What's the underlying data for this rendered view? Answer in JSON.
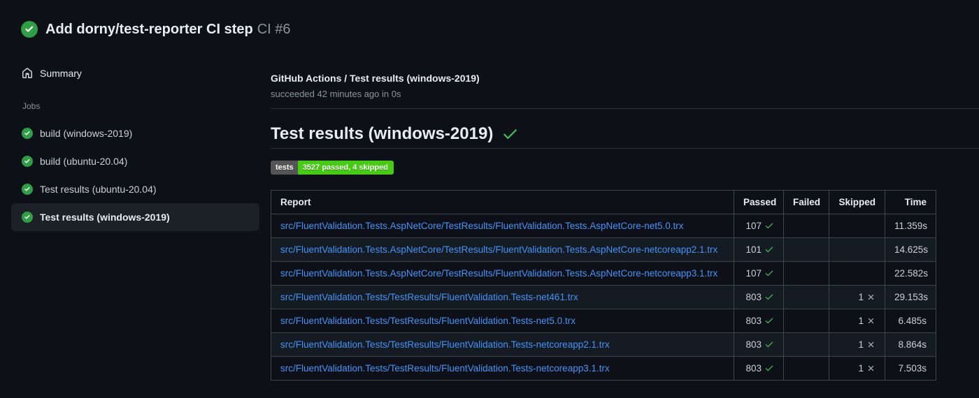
{
  "run_header": {
    "title": "Add dorny/test-reporter CI step",
    "run_ref": "CI #6",
    "status_icon": "check-circle-icon"
  },
  "sidebar": {
    "summary_label": "Summary",
    "summary_icon": "home-icon",
    "jobs_label": "Jobs",
    "jobs": [
      {
        "label": "build (windows-2019)",
        "selected": false,
        "status_icon": "check-circle-icon"
      },
      {
        "label": "build (ubuntu-20.04)",
        "selected": false,
        "status_icon": "check-circle-icon"
      },
      {
        "label": "Test results (ubuntu-20.04)",
        "selected": false,
        "status_icon": "check-circle-icon"
      },
      {
        "label": "Test results (windows-2019)",
        "selected": true,
        "status_icon": "check-circle-icon"
      }
    ]
  },
  "job_header": {
    "title": "GitHub Actions / Test results (windows-2019)",
    "status_line": "succeeded 42 minutes ago in 0s"
  },
  "report": {
    "title": "Test results (windows-2019)",
    "title_icon": "check-icon",
    "badge": {
      "label": "tests",
      "value": "3527 passed, 4 skipped"
    },
    "table": {
      "columns": [
        "Report",
        "Passed",
        "Failed",
        "Skipped",
        "Time"
      ],
      "rows": [
        {
          "report": "src/FluentValidation.Tests.AspNetCore/TestResults/FluentValidation.Tests.AspNetCore-net5.0.trx",
          "passed": "107",
          "failed": "",
          "skipped": "",
          "time": "11.359s"
        },
        {
          "report": "src/FluentValidation.Tests.AspNetCore/TestResults/FluentValidation.Tests.AspNetCore-netcoreapp2.1.trx",
          "passed": "101",
          "failed": "",
          "skipped": "",
          "time": "14.625s"
        },
        {
          "report": "src/FluentValidation.Tests.AspNetCore/TestResults/FluentValidation.Tests.AspNetCore-netcoreapp3.1.trx",
          "passed": "107",
          "failed": "",
          "skipped": "",
          "time": "22.582s"
        },
        {
          "report": "src/FluentValidation.Tests/TestResults/FluentValidation.Tests-net461.trx",
          "passed": "803",
          "failed": "",
          "skipped": "1",
          "time": "29.153s"
        },
        {
          "report": "src/FluentValidation.Tests/TestResults/FluentValidation.Tests-net5.0.trx",
          "passed": "803",
          "failed": "",
          "skipped": "1",
          "time": "6.485s"
        },
        {
          "report": "src/FluentValidation.Tests/TestResults/FluentValidation.Tests-netcoreapp2.1.trx",
          "passed": "803",
          "failed": "",
          "skipped": "1",
          "time": "8.864s"
        },
        {
          "report": "src/FluentValidation.Tests/TestResults/FluentValidation.Tests-netcoreapp3.1.trx",
          "passed": "803",
          "failed": "",
          "skipped": "1",
          "time": "7.503s"
        }
      ]
    }
  },
  "colors": {
    "page_bg": "#0d1117",
    "green_circle": "#2ea043",
    "check_green": "#3fb950",
    "x_gray": "#a8b2bd",
    "link_blue": "#4493f8",
    "badge_label_bg": "#555555",
    "badge_value_bg": "#44cc11",
    "selected_job_bg": "#1c2128"
  }
}
